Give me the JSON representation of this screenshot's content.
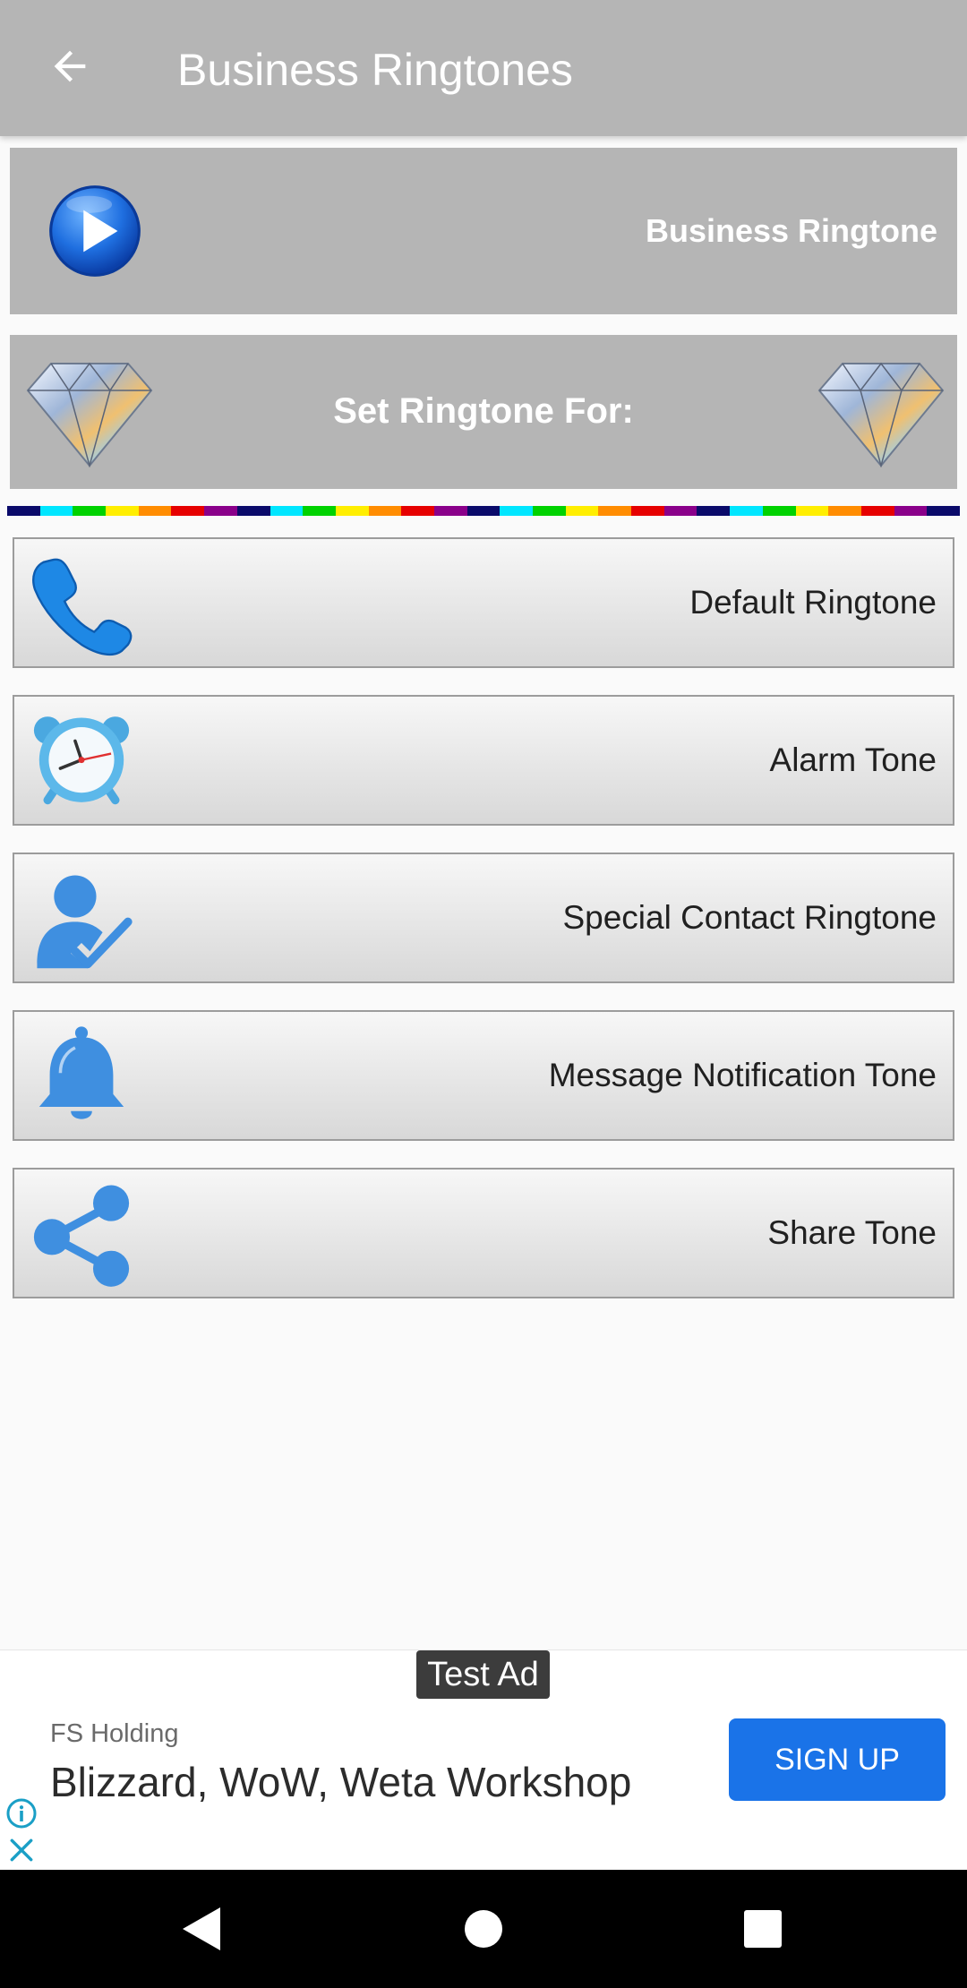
{
  "appbar": {
    "title": "Business Ringtones",
    "back_icon": "arrow-left-icon"
  },
  "play_banner": {
    "label": "Business Ringtone",
    "icon": "play-circle-icon"
  },
  "set_banner": {
    "label": "Set Ringtone For:",
    "icons": [
      "diamond-icon",
      "diamond-icon"
    ]
  },
  "color_strip": {
    "colors": [
      "#0a0a6a",
      "#00e6ff",
      "#00d200",
      "#ffee00",
      "#ff8c00",
      "#e60000",
      "#8a008a",
      "#0a0a6a",
      "#00e6ff",
      "#00d200",
      "#ffee00",
      "#ff8c00",
      "#e60000",
      "#8a008a",
      "#0a0a6a",
      "#00e6ff",
      "#00d200",
      "#ffee00",
      "#ff8c00",
      "#e60000",
      "#8a008a",
      "#0a0a6a",
      "#00e6ff",
      "#00d200",
      "#ffee00",
      "#ff8c00",
      "#e60000",
      "#8a008a",
      "#0a0a6a"
    ]
  },
  "options": [
    {
      "label": "Default Ringtone",
      "icon": "phone-icon"
    },
    {
      "label": "Alarm Tone",
      "icon": "alarm-clock-icon"
    },
    {
      "label": "Special Contact Ringtone",
      "icon": "contact-check-icon"
    },
    {
      "label": "Message Notification Tone",
      "icon": "bell-icon"
    },
    {
      "label": "Share Tone",
      "icon": "share-icon"
    }
  ],
  "ad": {
    "badge": "Test Ad",
    "advertiser": "FS Holding",
    "headline": "Blizzard, WoW, Weta Workshop",
    "cta": "SIGN UP",
    "info_icon": "info-icon",
    "close_icon": "close-icon"
  },
  "navbar": {
    "icons": [
      "nav-back-icon",
      "nav-home-icon",
      "nav-recents-icon"
    ]
  },
  "colors": {
    "appbar": "#b5b5b5",
    "accent_blue": "#3b8ee8",
    "cta_blue": "#1a73e8"
  }
}
